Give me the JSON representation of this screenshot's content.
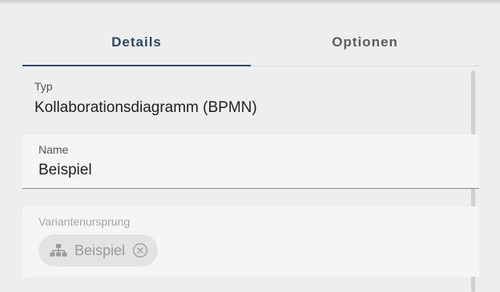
{
  "tabs": [
    {
      "label": "Details",
      "active": true
    },
    {
      "label": "Optionen",
      "active": false
    }
  ],
  "typ": {
    "label": "Typ",
    "value": "Kollaborationsdiagramm (BPMN)"
  },
  "name_field": {
    "label": "Name",
    "value": "Beispiel"
  },
  "variant_field": {
    "label": "Variantenursprung",
    "chip": {
      "icon": "hierarchy-icon",
      "label": "Beispiel",
      "remove_icon": "close-circle-icon"
    }
  },
  "colors": {
    "accent": "#2d4a66",
    "background": "#eeeeee",
    "field_background": "#f5f5f5",
    "disabled_text": "#9a9a9a"
  }
}
